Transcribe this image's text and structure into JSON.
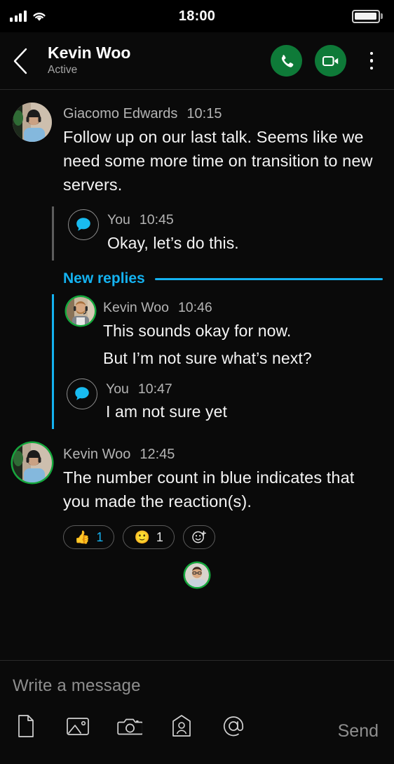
{
  "status_bar": {
    "time": "18:00",
    "signal_icon": "signal-bars-icon",
    "wifi_icon": "wifi-icon",
    "battery_icon": "battery-full-icon"
  },
  "header": {
    "back_icon": "chevron-left-icon",
    "title": "Kevin Woo",
    "status": "Active",
    "call_icon": "phone-icon",
    "video_icon": "video-camera-icon",
    "menu_icon": "kebab-menu-icon",
    "accent_green": "#0e7a38"
  },
  "theme": {
    "background": "#0a0a0a",
    "accent_blue": "#14b2f0",
    "online_green": "#14a83c",
    "text_primary": "#f4f4f4",
    "text_secondary": "#b4b4b4"
  },
  "conversation": {
    "root_message": {
      "author": "Giacomo Edwards",
      "time": "10:15",
      "text": "Follow up on our last talk. Seems like we need some more time on transition to new servers.",
      "avatar_name": "avatar-giacomo-edwards"
    },
    "thread_old": [
      {
        "author": "You",
        "time": "10:45",
        "text": "Okay, let’s do this.",
        "avatar_name": "avatar-you-bubble"
      }
    ],
    "new_replies_divider": {
      "label": "New replies"
    },
    "thread_new": [
      {
        "author": "Kevin Woo",
        "time": "10:46",
        "text": "This sounds okay for now.",
        "text2": "But I’m not sure what’s next?",
        "avatar_name": "avatar-kevin-woo"
      },
      {
        "author": "You",
        "time": "10:47",
        "text": "I am not sure yet",
        "avatar_name": "avatar-you-bubble"
      }
    ],
    "last_message": {
      "author": "Kevin Woo",
      "time": "12:45",
      "text": "The number count in blue indicates that you made the reaction(s).",
      "avatar_name": "avatar-kevin-woo-2",
      "reactions": [
        {
          "emoji": "👍",
          "count": "1",
          "mine": true,
          "name": "reaction-thumbs-up"
        },
        {
          "emoji": "🙂",
          "count": "1",
          "mine": false,
          "name": "reaction-smiley"
        }
      ],
      "add_reaction_icon": "add-reaction-icon"
    },
    "read_receipt": {
      "avatar_name": "read-receipt-avatar"
    }
  },
  "composer": {
    "placeholder": "Write a message",
    "value": "",
    "send_label": "Send",
    "tools": [
      {
        "name": "attach-file-icon",
        "label": "file"
      },
      {
        "name": "attach-image-icon",
        "label": "image"
      },
      {
        "name": "camera-icon",
        "label": "camera"
      },
      {
        "name": "contact-card-icon",
        "label": "contact"
      },
      {
        "name": "mention-icon",
        "label": "mention"
      }
    ]
  }
}
